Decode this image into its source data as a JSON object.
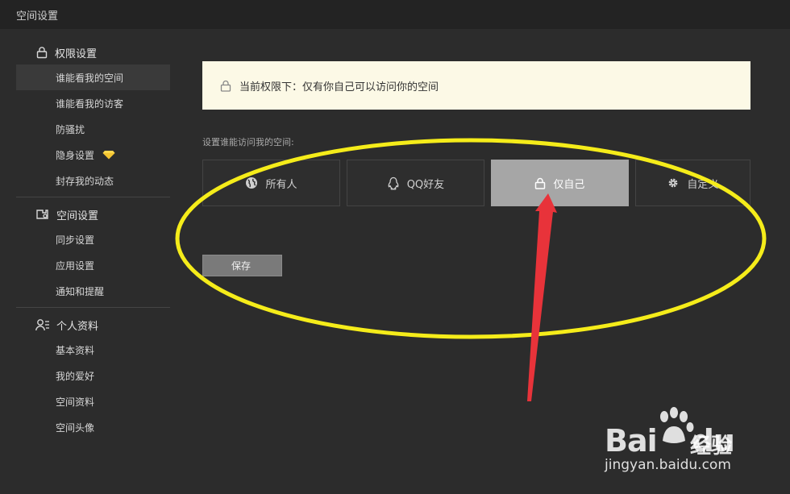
{
  "window": {
    "title": "空间设置"
  },
  "sidebar": {
    "groups": [
      {
        "title": "权限设置",
        "icon": "lock-icon",
        "items": [
          {
            "label": "谁能看我的空间",
            "active": true
          },
          {
            "label": "谁能看我的访客"
          },
          {
            "label": "防骚扰"
          },
          {
            "label": "隐身设置",
            "badge": "diamond-icon"
          },
          {
            "label": "封存我的动态"
          }
        ]
      },
      {
        "title": "空间设置",
        "icon": "space-settings-icon",
        "items": [
          {
            "label": "同步设置"
          },
          {
            "label": "应用设置"
          },
          {
            "label": "通知和提醒"
          }
        ]
      },
      {
        "title": "个人资料",
        "icon": "profile-icon",
        "items": [
          {
            "label": "基本资料"
          },
          {
            "label": "我的爱好"
          },
          {
            "label": "空间资料"
          },
          {
            "label": "空间头像"
          }
        ]
      }
    ]
  },
  "main": {
    "notice": "当前权限下：仅有你自己可以访问你的空间",
    "section_label": "设置谁能访问我的空间:",
    "options": [
      {
        "label": "所有人",
        "icon": "globe-icon"
      },
      {
        "label": "QQ好友",
        "icon": "qq-icon"
      },
      {
        "label": "仅自己",
        "icon": "lock-icon",
        "selected": true
      },
      {
        "label": "自定义",
        "icon": "gear-icon"
      }
    ],
    "save_label": "保存"
  },
  "annotation": {
    "ellipse_color": "#f5ec1a",
    "arrow_color": "#e8333a"
  },
  "watermark": {
    "brand": "Bai",
    "brand2": "du",
    "sub": "经验",
    "url": "jingyan.baidu.com"
  }
}
